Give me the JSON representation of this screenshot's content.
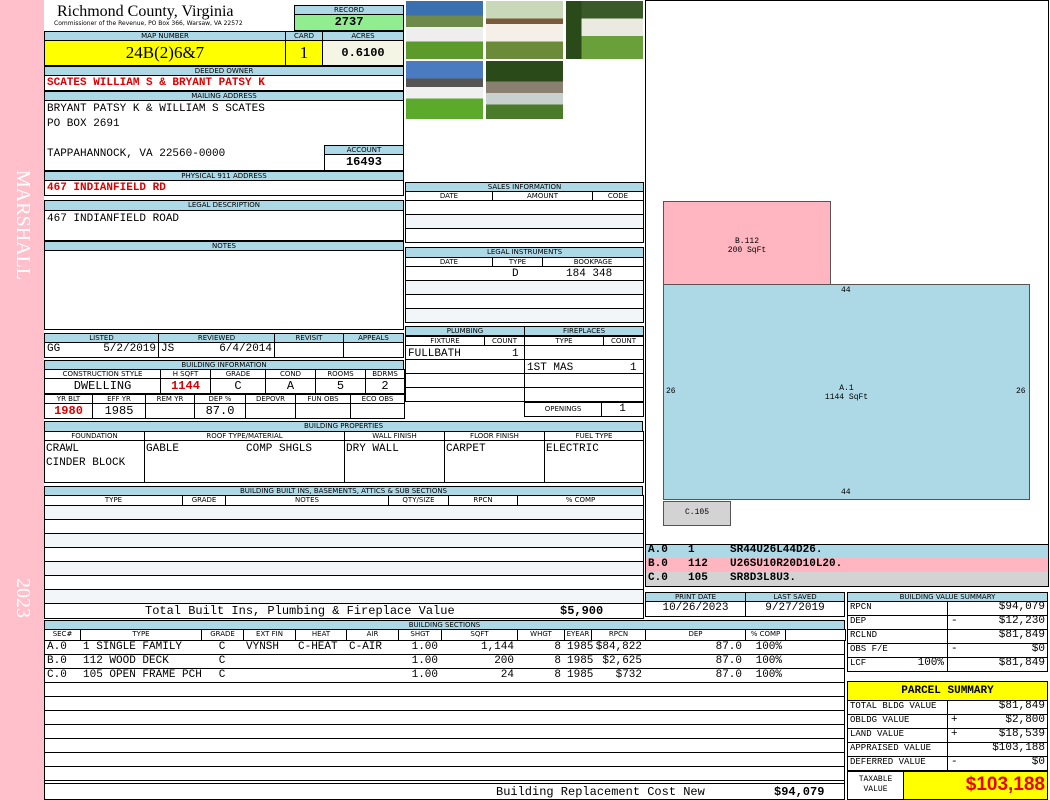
{
  "sidebar": {
    "district": "MARSHALL",
    "year": "2023"
  },
  "header": {
    "county": "Richmond County, Virginia",
    "office": "Commissioner of the Revenue, PO Box 366, Warsaw, VA 22572",
    "record_label": "RECORD",
    "record": "2737"
  },
  "parcel": {
    "map_label": "MAP NUMBER",
    "map": "24B(2)6&7",
    "card_label": "CARD",
    "card": "1",
    "acres_label": "ACRES",
    "acres": "0.6100"
  },
  "owner": {
    "label": "DEEDED OWNER",
    "name": "SCATES WILLIAM S & BRYANT PATSY K"
  },
  "mailing": {
    "label": "MAILING ADDRESS",
    "lines": [
      "BRYANT PATSY K & WILLIAM S SCATES",
      "PO BOX 2691",
      "TAPPAHANNOCK, VA 22560-0000"
    ],
    "account_label": "ACCOUNT",
    "account": "16493"
  },
  "physical": {
    "label": "PHYSICAL 911 ADDRESS",
    "address": "467 INDIANFIELD RD"
  },
  "legal": {
    "label": "LEGAL DESCRIPTION",
    "text": "467 INDIANFIELD ROAD"
  },
  "notes": {
    "label": "NOTES"
  },
  "listing": {
    "listed_label": "LISTED",
    "reviewed_label": "REVIEWED",
    "revisit_label": "REVISIT",
    "appeals_label": "APPEALS",
    "listed_by": "GG",
    "listed_date": "5/2/2019",
    "reviewed_by": "JS",
    "reviewed_date": "6/4/2014"
  },
  "building_info": {
    "label": "BUILDING INFORMATION",
    "headers1": [
      "CONSTRUCTION STYLE",
      "H SQFT",
      "GRADE",
      "COND",
      "ROOMS",
      "BDRMS"
    ],
    "values1": [
      "DWELLING",
      "1144",
      "C",
      "A",
      "5",
      "2"
    ],
    "headers2": [
      "YR BLT",
      "EFF YR",
      "REM YR",
      "DEP %",
      "DEPOVR",
      "FUN OBS",
      "ECO OBS"
    ],
    "values2": [
      "1980",
      "1985",
      "",
      "87.0",
      "",
      "",
      ""
    ]
  },
  "properties": {
    "label": "BUILDING PROPERTIES",
    "headers": [
      "FOUNDATION",
      "ROOF TYPE/MATERIAL",
      "WALL FINISH",
      "FLOOR FINISH",
      "FUEL TYPE"
    ],
    "foundation": [
      "CRAWL",
      "CINDER BLOCK"
    ],
    "roof_type": "GABLE",
    "roof_material": "COMP SHGLS",
    "wall": "DRY WALL",
    "floor": "CARPET",
    "fuel": "ELECTRIC"
  },
  "builtins": {
    "label": "BUILDING BUILT INS, BASEMENTS, ATTICS & SUB SECTIONS",
    "headers": [
      "TYPE",
      "GRADE",
      "NOTES",
      "QTY/SIZE",
      "RPCN",
      "% COMP"
    ],
    "total_label": "Total Built Ins, Plumbing & Fireplace Value",
    "total": "$5,900"
  },
  "sections": {
    "label": "BUILDING SECTIONS",
    "headers": [
      "SEC#",
      "TYPE",
      "GRADE",
      "EXT FIN",
      "HEAT",
      "AIR",
      "SHGT",
      "SQFT",
      "WHGT",
      "EYEAR",
      "RPCN",
      "DEP",
      "% COMP"
    ],
    "rows": [
      [
        "A.0",
        "1 SINGLE FAMILY",
        "C",
        "VYNSH",
        "C-HEAT",
        "C-AIR",
        "1.00",
        "1,144",
        "8",
        "1985",
        "$84,822",
        "87.0",
        "100%"
      ],
      [
        "B.0",
        "112 WOOD DECK",
        "C",
        "",
        "",
        "",
        "1.00",
        "200",
        "8",
        "1985",
        "$2,625",
        "87.0",
        "100%"
      ],
      [
        "C.0",
        "105 OPEN FRAME PCH",
        "C",
        "",
        "",
        "",
        "1.00",
        "24",
        "8",
        "1985",
        "$732",
        "87.0",
        "100%"
      ]
    ],
    "footer_label": "Building Replacement Cost New",
    "footer_value": "$94,079"
  },
  "sales": {
    "label": "SALES INFORMATION",
    "headers": [
      "DATE",
      "AMOUNT",
      "CODE"
    ]
  },
  "instruments": {
    "label": "LEGAL INSTRUMENTS",
    "headers": [
      "DATE",
      "TYPE",
      "BOOKPAGE"
    ],
    "type": "D",
    "bookpage": "184 348"
  },
  "plumbing": {
    "label": "PLUMBING",
    "headers": [
      "FIXTURE",
      "COUNT"
    ],
    "fixture": "FULLBATH",
    "count": "1"
  },
  "fireplaces": {
    "label": "FIREPLACES",
    "headers": [
      "TYPE",
      "COUNT"
    ],
    "type": "1ST MAS",
    "count": "1",
    "openings_label": "OPENINGS",
    "openings": "1"
  },
  "sketch": {
    "areas": [
      {
        "name": "B.112",
        "sqft": "200 SqFt"
      },
      {
        "name": "A.1",
        "sqft": "1144 SqFt"
      },
      {
        "name": "C.105"
      }
    ],
    "dims": {
      "top": "44",
      "bottom": "44",
      "left": "26",
      "right": "26"
    },
    "legend": [
      {
        "sec": "A.0",
        "code": "1",
        "path": "SR44U26L44D26.",
        "color": "#add8e6"
      },
      {
        "sec": "B.0",
        "code": "112",
        "path": "U26SU10R20D10L20.",
        "color": "#ffb6c1"
      },
      {
        "sec": "C.0",
        "code": "105",
        "path": "SR8D3L8U3.",
        "color": "#d3d3d3"
      }
    ]
  },
  "dates": {
    "print_label": "PRINT DATE",
    "print": "10/26/2023",
    "saved_label": "LAST SAVED",
    "saved": "9/27/2019"
  },
  "bvs": {
    "label": "BUILDING VALUE SUMMARY",
    "rows": [
      {
        "l": "RPCN",
        "s": "",
        "v": "$94,079"
      },
      {
        "l": "DEP",
        "s": "-",
        "v": "$12,230"
      },
      {
        "l": "RCLND",
        "s": "",
        "v": "$81,849"
      },
      {
        "l": "OBS F/E",
        "s": "-",
        "v": "$0"
      },
      {
        "l": "LCF",
        "p": "100%",
        "s": "",
        "v": "$81,849"
      }
    ]
  },
  "parcel_summary": {
    "label": "PARCEL SUMMARY",
    "rows": [
      {
        "l": "TOTAL BLDG VALUE",
        "s": "",
        "v": "$81,849"
      },
      {
        "l": "OBLDG VALUE",
        "s": "+",
        "v": "$2,800"
      },
      {
        "l": "LAND VALUE",
        "s": "+",
        "v": "$18,539"
      },
      {
        "l": "APPRAISED VALUE",
        "s": "",
        "v": "$103,188"
      },
      {
        "l": "DEFERRED VALUE",
        "s": "-",
        "v": "$0"
      }
    ],
    "taxable_label": "TAXABLE VALUE",
    "taxable": "$103,188"
  }
}
